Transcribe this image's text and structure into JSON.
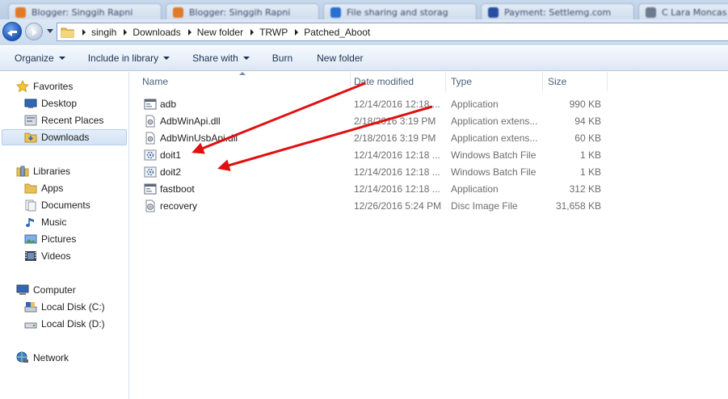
{
  "browser_tabs": [
    {
      "label": "Blogger: Singgih Rapni",
      "color": "#e0792a"
    },
    {
      "label": "Blogger: Singgih Rapni",
      "color": "#e0792a"
    },
    {
      "label": "File sharing and storag",
      "color": "#2a6fd0"
    },
    {
      "label": "Payment: Settlemg.com",
      "color": "#2a4fa0"
    },
    {
      "label": "C Lara Moncas",
      "color": "#6b7a8c"
    }
  ],
  "address": {
    "crumbs": [
      "singih",
      "Downloads",
      "New folder",
      "TRWP",
      "Patched_Aboot"
    ]
  },
  "toolbar": {
    "organize": "Organize",
    "include_in_library": "Include in library",
    "share_with": "Share with",
    "burn": "Burn",
    "new_folder": "New folder"
  },
  "nav": {
    "favorites": "Favorites",
    "desktop": "Desktop",
    "recent_places": "Recent Places",
    "downloads": "Downloads",
    "libraries": "Libraries",
    "apps": "Apps",
    "documents": "Documents",
    "music": "Music",
    "pictures": "Pictures",
    "videos": "Videos",
    "computer": "Computer",
    "local_disk_c": "Local Disk (C:)",
    "local_disk_d": "Local Disk (D:)",
    "network": "Network"
  },
  "columns": {
    "name": "Name",
    "date_modified": "Date modified",
    "type": "Type",
    "size": "Size"
  },
  "files": [
    {
      "name": "adb",
      "date": "12/14/2016 12:18 ...",
      "type": "Application",
      "size": "990 KB",
      "icon": "application-icon"
    },
    {
      "name": "AdbWinApi.dll",
      "date": "2/18/2016 3:19 PM",
      "type": "Application extens...",
      "size": "94 KB",
      "icon": "dll-icon"
    },
    {
      "name": "AdbWinUsbApi.dll",
      "date": "2/18/2016 3:19 PM",
      "type": "Application extens...",
      "size": "60 KB",
      "icon": "dll-icon"
    },
    {
      "name": "doit1",
      "date": "12/14/2016 12:18 ...",
      "type": "Windows Batch File",
      "size": "1 KB",
      "icon": "batch-file-icon"
    },
    {
      "name": "doit2",
      "date": "12/14/2016 12:18 ...",
      "type": "Windows Batch File",
      "size": "1 KB",
      "icon": "batch-file-icon"
    },
    {
      "name": "fastboot",
      "date": "12/14/2016 12:18 ...",
      "type": "Application",
      "size": "312 KB",
      "icon": "application-icon"
    },
    {
      "name": "recovery",
      "date": "12/26/2016 5:24 PM",
      "type": "Disc Image File",
      "size": "31,658 KB",
      "icon": "disc-image-icon"
    }
  ],
  "annotation_color": "#e01010"
}
